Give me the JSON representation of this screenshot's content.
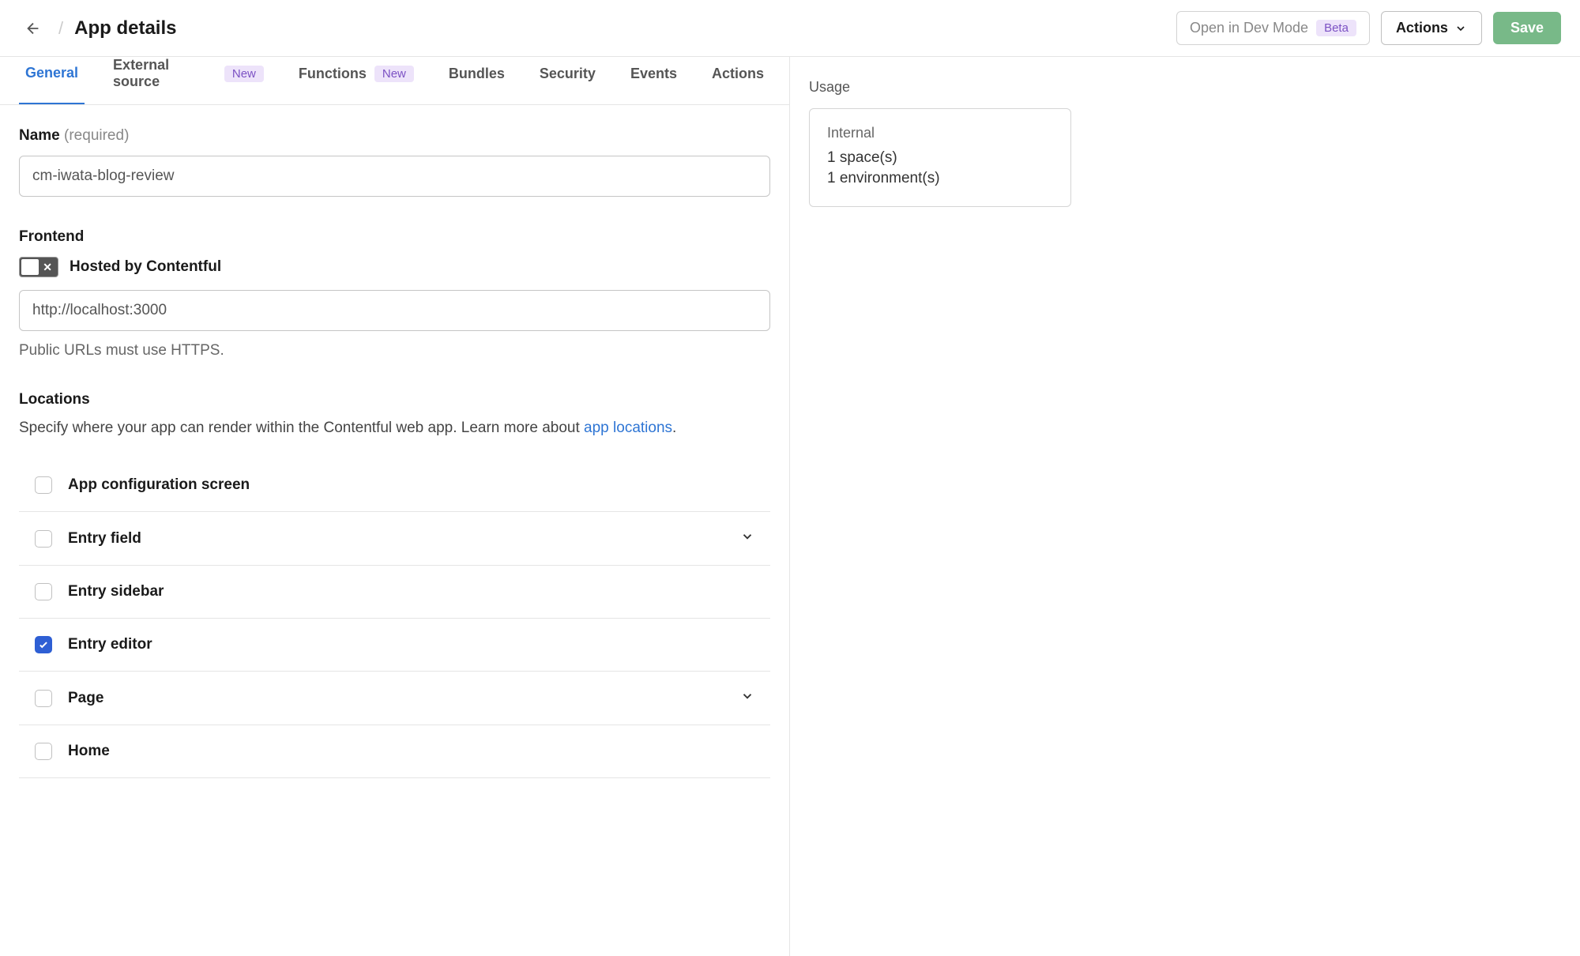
{
  "header": {
    "title": "App details",
    "dev_mode_label": "Open in Dev Mode",
    "beta_label": "Beta",
    "actions_label": "Actions",
    "save_label": "Save"
  },
  "tabs": {
    "general": "General",
    "external_source": "External source",
    "functions": "Functions",
    "bundles": "Bundles",
    "security": "Security",
    "events": "Events",
    "actions": "Actions",
    "new_badge": "New"
  },
  "form": {
    "name_label": "Name",
    "name_required": "(required)",
    "name_value": "cm-iwata-blog-review",
    "frontend_label": "Frontend",
    "hosted_label": "Hosted by Contentful",
    "url_value": "http://localhost:3000",
    "url_helper": "Public URLs must use HTTPS.",
    "locations_label": "Locations",
    "locations_desc_1": "Specify where your app can render within the Contentful web app. Learn more about ",
    "locations_link": "app locations",
    "locations_desc_2": "."
  },
  "locations": [
    {
      "label": "App configuration screen",
      "checked": false,
      "expandable": false
    },
    {
      "label": "Entry field",
      "checked": false,
      "expandable": true
    },
    {
      "label": "Entry sidebar",
      "checked": false,
      "expandable": false
    },
    {
      "label": "Entry editor",
      "checked": true,
      "expandable": false
    },
    {
      "label": "Page",
      "checked": false,
      "expandable": true
    },
    {
      "label": "Home",
      "checked": false,
      "expandable": false
    }
  ],
  "sidebar": {
    "usage_heading": "Usage",
    "internal_label": "Internal",
    "spaces_line": "1 space(s)",
    "environments_line": "1 environment(s)"
  }
}
